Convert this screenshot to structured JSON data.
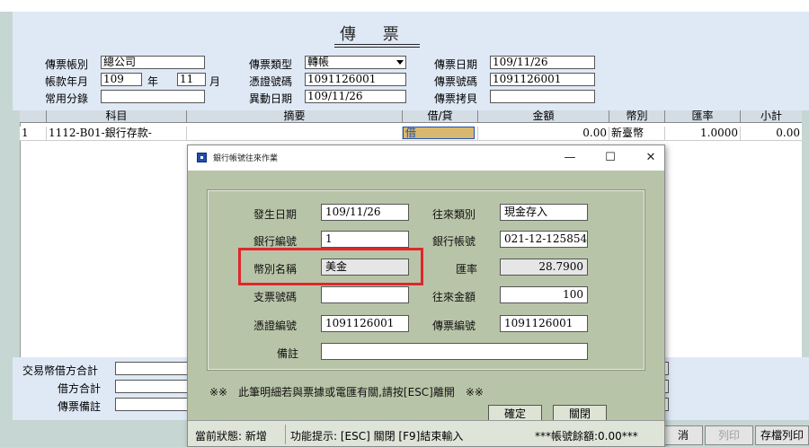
{
  "header": {
    "title": "傳 票",
    "voucher_account_label": "傳票帳別",
    "voucher_account_value": "總公司",
    "voucher_type_label": "傳票類型",
    "voucher_type_value": "轉帳",
    "voucher_date_label": "傳票日期",
    "voucher_date_value": "109/11/26",
    "period_label": "帳款年月",
    "period_year": "109",
    "year_unit": "年",
    "period_month": "11",
    "month_unit": "月",
    "credential_no_label": "憑證號碼",
    "credential_no_value": "1091126001",
    "voucher_no_label": "傳票號碼",
    "voucher_no_value": "1091126001",
    "common_entry_label": "常用分錄",
    "common_entry_value": "",
    "change_date_label": "異動日期",
    "change_date_value": "109/11/26",
    "voucher_copier_label": "傳票拷貝",
    "voucher_copier_value": ""
  },
  "grid": {
    "columns": [
      "科目",
      "摘要",
      "借/貸",
      "金額",
      "幣別",
      "匯率",
      "小計"
    ],
    "rows": [
      {
        "index": "1",
        "account": "1112-B01-銀行存款-",
        "summary": "",
        "dc": "借",
        "amount": "0.00",
        "currency": "新臺幣",
        "rate": "1.0000",
        "subtotal": "0.00"
      }
    ]
  },
  "bottom": {
    "trade_debit_total_label": "交易幣借方合計",
    "debit_total_label": "借方合計",
    "voucher_note_label": "傳票備註"
  },
  "buttons": {
    "cancel_partial": "消",
    "print": "列印",
    "save_print": "存檔列印"
  },
  "dialog": {
    "title": "銀行帳號往來作業",
    "minimize": "—",
    "maximize": "☐",
    "close": "✕",
    "date_label": "發生日期",
    "date_value": "109/11/26",
    "type_label": "往來類別",
    "type_value": "現金存入",
    "bank_no_label": "銀行編號",
    "bank_no_value": "1",
    "bank_account_label": "銀行帳號",
    "bank_account_value": "021-12-125854",
    "currency_name_label": "幣別名稱",
    "currency_name_value": "美金",
    "rate_label": "匯率",
    "rate_value": "28.7900",
    "cheque_no_label": "支票號碼",
    "cheque_no_value": "",
    "amount_label": "往來金額",
    "amount_value": "100",
    "credential_label": "憑證編號",
    "credential_value": "1091126001",
    "voucher_no_label": "傳票編號",
    "voucher_no_value": "1091126001",
    "note_label": "備註",
    "note_value": "",
    "hint": "※※　此筆明細若與票據或電匯有關,請按[ESC]離開　※※",
    "confirm": "確定",
    "close_button": "關閉",
    "status_state": "當前狀態: 新增",
    "status_hint": "功能提示: [ESC] 關閉 [F9]結束輸入",
    "status_balance": "***帳號餘額:0.00***"
  },
  "colors": {
    "highlight": "#e0262b",
    "dialog_bg": "#b8c4a8",
    "header_bg": "#dfe9f6"
  }
}
